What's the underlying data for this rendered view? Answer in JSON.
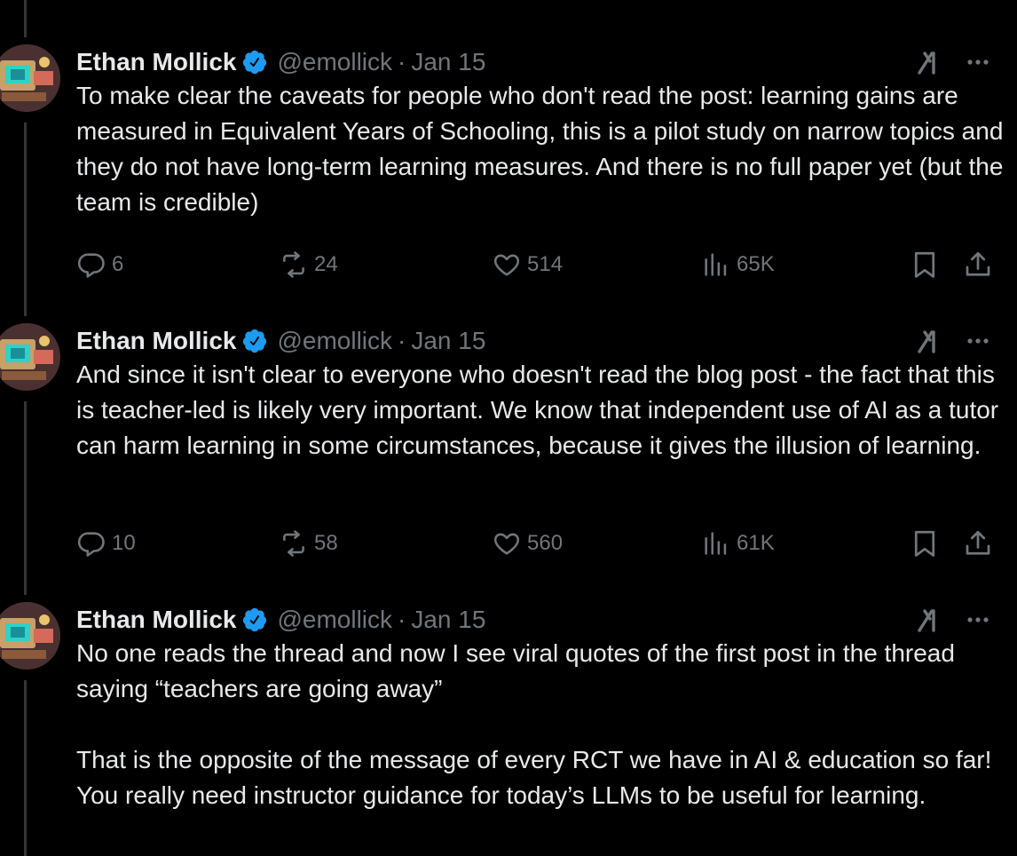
{
  "colors": {
    "background": "#000000",
    "text": "#e7e9ea",
    "muted": "#71767b",
    "verified": "#1d9bf0",
    "thread_line": "#333639"
  },
  "icons": {
    "verified": "verified-badge-icon",
    "grok": "grok-icon",
    "more": "more-icon",
    "reply": "reply-icon",
    "repost": "repost-icon",
    "like": "like-icon",
    "views": "views-icon",
    "bookmark": "bookmark-icon",
    "share": "share-icon"
  },
  "tweets": [
    {
      "name": "Ethan Mollick",
      "handle": "@emollick",
      "sep": "·",
      "date": "Jan 15",
      "text": "To make clear the caveats for people who don't read the post: learning gains are measured in Equivalent Years of Schooling, this is a pilot study on narrow topics and they do not have long-term learning measures. And there is no full paper yet (but the team is credible)",
      "replies": "6",
      "reposts": "24",
      "likes": "514",
      "views": "65K"
    },
    {
      "name": "Ethan Mollick",
      "handle": "@emollick",
      "sep": "·",
      "date": "Jan 15",
      "text": "And since it isn't clear to everyone who doesn't read the blog post - the fact that this is teacher-led is likely very important. We know that independent use of AI as a tutor can harm learning in some circumstances, because it gives the illusion of learning.",
      "replies": "10",
      "reposts": "58",
      "likes": "560",
      "views": "61K"
    },
    {
      "name": "Ethan Mollick",
      "handle": "@emollick",
      "sep": "·",
      "date": "Jan 15",
      "text": "No one reads the thread and now I see viral quotes of the first post in the thread saying “teachers are going away”\n\nThat is the opposite of the message of every RCT we have in AI & education so far! You really need instructor guidance for today’s LLMs to be useful for learning."
    }
  ]
}
